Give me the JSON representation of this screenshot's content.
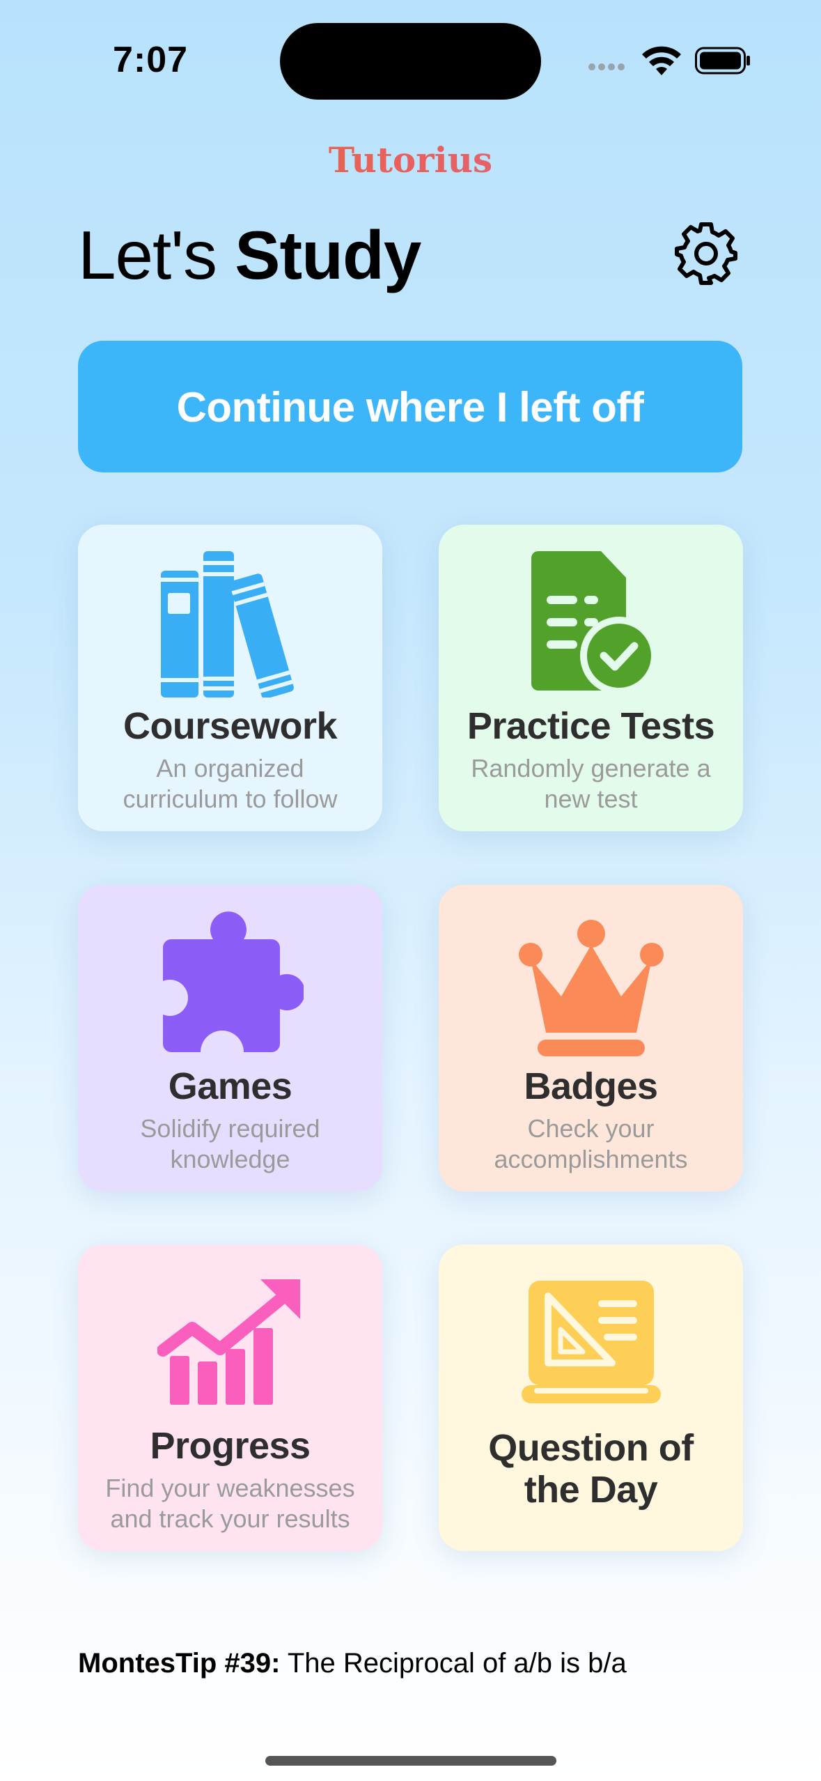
{
  "status_bar": {
    "time": "7:07"
  },
  "app": {
    "brand": "Tutorius"
  },
  "header": {
    "title_light": "Let's ",
    "title_bold": "Study",
    "settings_icon": "gear-icon"
  },
  "continue_button": {
    "label": "Continue where I left off",
    "color": "#3db5f9"
  },
  "cards": [
    {
      "title": "Coursework",
      "subtitle": "An organized curriculum to follow",
      "icon": "books-icon",
      "bg": "#e6f6ff",
      "accent": "#3aaef4"
    },
    {
      "title": "Practice Tests",
      "subtitle": "Randomly generate a new test",
      "icon": "test-document-check-icon",
      "bg": "#e2fbea",
      "accent": "#52a12a"
    },
    {
      "title": "Games",
      "subtitle": "Solidify required knowledge",
      "icon": "puzzle-piece-icon",
      "bg": "#e7ddfe",
      "accent": "#8c5cf7"
    },
    {
      "title": "Badges",
      "subtitle": "Check your accomplishments",
      "icon": "crown-icon",
      "bg": "#ffe6db",
      "accent": "#fa8a57"
    },
    {
      "title": "Progress",
      "subtitle": "Find your weaknesses and track your results",
      "icon": "chart-up-icon",
      "bg": "#ffe3f1",
      "accent": "#fb5fbd"
    },
    {
      "title": "Question of the Day",
      "subtitle": "",
      "icon": "geometry-board-icon",
      "bg": "#fff8de",
      "accent": "#fdcf57"
    }
  ],
  "footer": {
    "tip_label": "MontesTip #39:",
    "tip_text": " The Reciprocal of a/b is b/a"
  }
}
